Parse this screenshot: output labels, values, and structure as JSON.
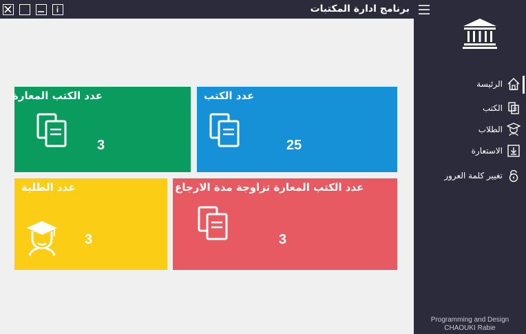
{
  "window": {
    "title": "برنامج ادارة المكتبات"
  },
  "sidebar": {
    "items": [
      {
        "label": "الرئيسة",
        "icon": "home-icon"
      },
      {
        "label": "الكتب",
        "icon": "books-icon"
      },
      {
        "label": "الطلاب",
        "icon": "student-icon"
      },
      {
        "label": "الاستعارة",
        "icon": "download-icon"
      },
      {
        "label": "تغيير كلمة العرور",
        "icon": "lock-icon"
      }
    ],
    "footer_line1": "Programming and Design",
    "footer_line2": "CHAOUKI Rabie"
  },
  "tiles": {
    "loaned": {
      "title": "عدد الكتب المعارة",
      "value": "3",
      "color": "#0a9b5f"
    },
    "books": {
      "title": "عدد الكتب",
      "value": "25",
      "color": "#1690d6"
    },
    "students": {
      "title": "عدد الطلبة",
      "value": "3",
      "color": "#fccd15"
    },
    "overdue": {
      "title": "عدد الكتب المعارة تزاوجة مدة الارجاع",
      "value": "3",
      "color": "#e85a61"
    }
  },
  "colors": {
    "sidebar_bg": "#2b2b3c",
    "content_bg": "#f0f0f0"
  }
}
